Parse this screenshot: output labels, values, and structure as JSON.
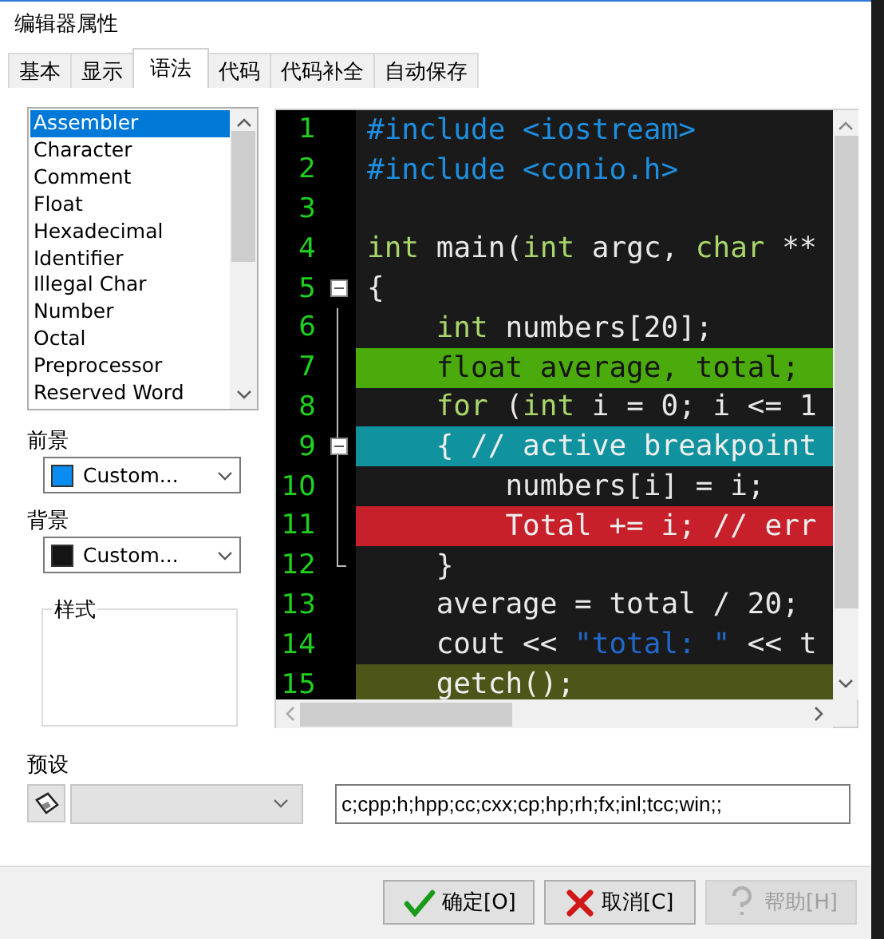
{
  "window": {
    "title": "编辑器属性"
  },
  "tabs": [
    {
      "label": "基本",
      "selected": false
    },
    {
      "label": "显示",
      "selected": false
    },
    {
      "label": "语法",
      "selected": true
    },
    {
      "label": "代码",
      "selected": false
    },
    {
      "label": "代码补全",
      "selected": false
    },
    {
      "label": "自动保存",
      "selected": false
    }
  ],
  "element_list": [
    {
      "label": "Assembler",
      "selected": true
    },
    {
      "label": "Character",
      "selected": false
    },
    {
      "label": "Comment",
      "selected": false
    },
    {
      "label": "Float",
      "selected": false
    },
    {
      "label": "Hexadecimal",
      "selected": false
    },
    {
      "label": "Identifier",
      "selected": false
    },
    {
      "label": "Illegal Char",
      "selected": false
    },
    {
      "label": "Number",
      "selected": false
    },
    {
      "label": "Octal",
      "selected": false
    },
    {
      "label": "Preprocessor",
      "selected": false
    },
    {
      "label": "Reserved Word",
      "selected": false
    }
  ],
  "color_settings": [
    {
      "label": "前景",
      "value": "Custom...",
      "color": "#0a8cf0"
    },
    {
      "label": "背景",
      "value": "Custom...",
      "color": "#141414"
    }
  ],
  "style_group": {
    "label": "样式"
  },
  "code_lines": [
    {
      "number": "1",
      "kind": "plain",
      "tokens": [
        {
          "text": "#include <iostream>",
          "kind": "preproc"
        }
      ]
    },
    {
      "number": "2",
      "kind": "plain",
      "tokens": [
        {
          "text": "#include <conio.h>",
          "kind": "preproc"
        }
      ]
    },
    {
      "number": "3",
      "kind": "plain"
    },
    {
      "number": "4",
      "kind": "plain",
      "tokens": [
        {
          "text": "int",
          "kind": "keyword"
        },
        {
          "text": " main(",
          "kind": "plain"
        },
        {
          "text": "int",
          "kind": "keyword"
        },
        {
          "text": " argc, ",
          "kind": "plain"
        },
        {
          "text": "char",
          "kind": "keyword"
        },
        {
          "text": " **",
          "kind": "plain"
        }
      ]
    },
    {
      "number": "5",
      "kind": "fold_start",
      "tokens": [
        {
          "text": "{",
          "kind": "plain"
        }
      ]
    },
    {
      "number": "6",
      "kind": "plain",
      "tokens": [
        {
          "text": "    int",
          "kind": "keyword"
        },
        {
          "text": " numbers[20];",
          "kind": "plain"
        }
      ]
    },
    {
      "number": "7",
      "kind": "plain",
      "color": "#4cab0c",
      "tokens": [
        {
          "text": "    float average, total;",
          "kind": "plain"
        }
      ]
    },
    {
      "number": "8",
      "kind": "plain",
      "tokens": [
        {
          "text": "    for",
          "kind": "keyword"
        },
        {
          "text": " (",
          "kind": "plain"
        },
        {
          "text": "int",
          "kind": "keyword"
        },
        {
          "text": " i = 0; i <= 1",
          "kind": "plain"
        }
      ]
    },
    {
      "number": "9",
      "kind": "fold_start",
      "color": "#11939f",
      "tokens": [
        {
          "text": "    { // active breakpoint",
          "kind": "plain"
        }
      ]
    },
    {
      "number": "10",
      "kind": "plain",
      "tokens": [
        {
          "text": "        numbers[i] = i;",
          "kind": "plain"
        }
      ]
    },
    {
      "number": "11",
      "kind": "plain",
      "color": "#c8202a",
      "tokens": [
        {
          "text": "        Total += i; // err",
          "kind": "plain"
        }
      ]
    },
    {
      "number": "12",
      "kind": "fold_end",
      "tokens": [
        {
          "text": "    }",
          "kind": "plain"
        }
      ]
    },
    {
      "number": "13",
      "kind": "plain",
      "tokens": [
        {
          "text": "    average = total / 20;",
          "kind": "plain"
        }
      ]
    },
    {
      "number": "14",
      "kind": "plain",
      "tokens": [
        {
          "text": "    cout << ",
          "kind": "plain"
        },
        {
          "text": "\"total: \"",
          "kind": "string"
        },
        {
          "text": " << t",
          "kind": "plain"
        }
      ]
    },
    {
      "number": "15",
      "kind": "plain",
      "color": "#4d5618",
      "tokens": [
        {
          "text": "    getch();",
          "kind": "plain"
        }
      ]
    }
  ],
  "preset": {
    "label": "预设",
    "extensions": "c;cpp;h;hpp;cc;cxx;cp;hp;rh;fx;inl;tcc;win;;"
  },
  "buttons": [
    {
      "label": "确定[O]",
      "kind": "ok",
      "disabled": false
    },
    {
      "label": "取消[C]",
      "kind": "cancel",
      "disabled": false
    },
    {
      "label": "帮助[H]",
      "kind": "help",
      "disabled": true
    }
  ]
}
